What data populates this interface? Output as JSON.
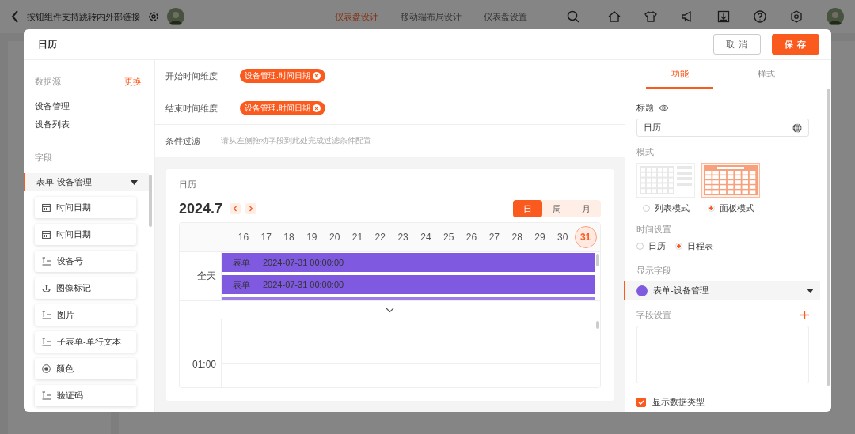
{
  "topbar": {
    "title": "按钮组件支持跳转内外部链接",
    "tabs": [
      {
        "label": "仪表盘设计",
        "selected": true
      },
      {
        "label": "移动端布局设计",
        "selected": false
      },
      {
        "label": "仪表盘设置",
        "selected": false
      }
    ]
  },
  "dialog": {
    "title": "日历",
    "buttons": [
      {
        "label": "取 消",
        "kind": "secondary"
      },
      {
        "label": "保 存",
        "kind": "primary"
      }
    ]
  },
  "datasource": {
    "label": "数据源",
    "action": "更换",
    "items": [
      "设备管理",
      "设备列表"
    ]
  },
  "fields": {
    "label": "字段",
    "group": {
      "label": "表单-设备管理",
      "expanded": true
    },
    "items": [
      {
        "kind": "date",
        "label": "时间日期"
      },
      {
        "kind": "date",
        "label": "时间日期"
      },
      {
        "kind": "text",
        "label": "设备号"
      },
      {
        "kind": "mark",
        "label": "图像标记"
      },
      {
        "kind": "text",
        "label": "图片"
      },
      {
        "kind": "text",
        "label": "子表单-单行文本"
      },
      {
        "kind": "radio",
        "label": "颜色"
      },
      {
        "kind": "text",
        "label": "验证码"
      }
    ]
  },
  "config": [
    {
      "label": "开始时间维度",
      "tag": "设备管理.时间日期"
    },
    {
      "label": "结束时间维度",
      "tag": "设备管理.时间日期"
    },
    {
      "label": "条件过滤",
      "hint": "请从左侧拖动字段到此处完成过滤条件配置"
    }
  ],
  "calendar": {
    "title": "日历",
    "month": "2024.7",
    "views": [
      {
        "label": "日",
        "selected": true
      },
      {
        "label": "周",
        "selected": false
      },
      {
        "label": "月",
        "selected": false
      }
    ],
    "days": [
      {
        "label": "16",
        "selected": false
      },
      {
        "label": "17",
        "selected": false
      },
      {
        "label": "18",
        "selected": false
      },
      {
        "label": "19",
        "selected": false
      },
      {
        "label": "20",
        "selected": false
      },
      {
        "label": "21",
        "selected": false
      },
      {
        "label": "22",
        "selected": false
      },
      {
        "label": "23",
        "selected": false
      },
      {
        "label": "24",
        "selected": false
      },
      {
        "label": "25",
        "selected": false
      },
      {
        "label": "26",
        "selected": false
      },
      {
        "label": "27",
        "selected": false
      },
      {
        "label": "28",
        "selected": false
      },
      {
        "label": "29",
        "selected": false
      },
      {
        "label": "30",
        "selected": false
      },
      {
        "label": "31",
        "selected": true
      }
    ],
    "all_day_label": "全天",
    "events": [
      {
        "form": "表单",
        "time": "2024-07-31 00:00:00"
      },
      {
        "form": "表单",
        "time": "2024-07-31 00:00:00"
      }
    ],
    "hours": [
      "01:00"
    ]
  },
  "settings": {
    "tabs": [
      {
        "label": "功能",
        "selected": true
      },
      {
        "label": "样式",
        "selected": false
      }
    ],
    "title_field": {
      "label": "标题",
      "value": "日历"
    },
    "mode": {
      "label": "模式",
      "options": [
        {
          "kind": "list",
          "label": "列表模式",
          "selected": false
        },
        {
          "kind": "board",
          "label": "面板模式",
          "selected": true
        }
      ]
    },
    "time_setting": {
      "label": "时间设置",
      "options": [
        {
          "label": "日历",
          "selected": false
        },
        {
          "label": "日程表",
          "selected": true
        }
      ]
    },
    "display_field": {
      "label": "显示字段",
      "value": "表单-设备管理"
    },
    "field_settings": {
      "label": "字段设置"
    },
    "show_data_type": {
      "label": "显示数据类型",
      "checked": true
    }
  }
}
